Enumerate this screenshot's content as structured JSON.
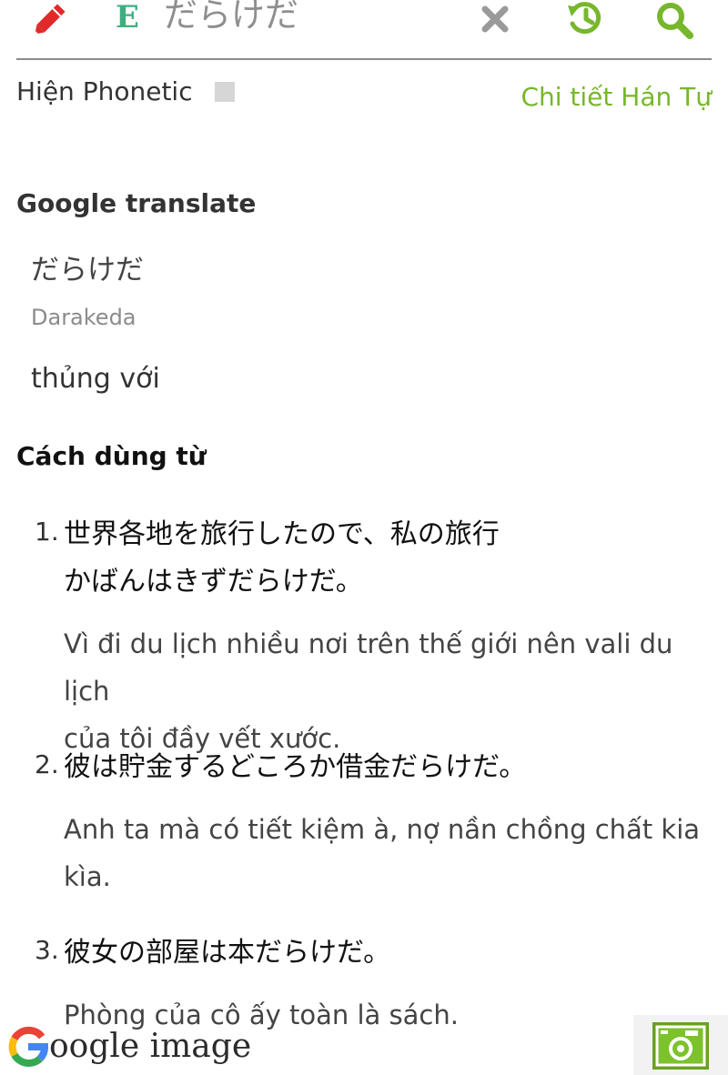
{
  "search": {
    "lang_badge": "E",
    "query": "だらけだ"
  },
  "phonetic": {
    "label": "Hiện Phonetic",
    "kanji_detail_link": "Chi tiết Hán Tự"
  },
  "google_translate": {
    "heading": "Google translate",
    "word": "だらけだ",
    "romaji": "Darakeda",
    "meaning": "thủng với"
  },
  "usage": {
    "heading": "Cách dùng từ",
    "examples": [
      {
        "number": "1.",
        "jp_line1": "世界各地を旅行したので、私の旅行",
        "jp_line2": "かばんはきずだらけだ。",
        "vi_line1": "Vì đi du lịch nhiều nơi trên thế giới nên vali du lịch",
        "vi_line2": "của tôi đầy vết xước."
      },
      {
        "number": "2.",
        "jp_line1": "彼は貯金するどころか借金だらけだ。",
        "vi_line1": "Anh ta mà có tiết kiệm à, nợ nần chồng chất kia",
        "vi_line2": "kìa."
      },
      {
        "number": "3.",
        "jp_line1": "彼女の部屋は本だらけだ。",
        "vi_line1": "Phòng của cô ấy toàn là sách."
      }
    ]
  },
  "footer": {
    "google_image_label": "oogle image",
    "google_image_logo_letter": "G"
  },
  "colors": {
    "accent_green": "#77b72c",
    "badge_green": "#3fae7f",
    "pencil_red": "#e02a2a",
    "clear_gray": "#9a9a9a"
  },
  "icons": {
    "edit": "pencil-icon",
    "clear": "close-icon",
    "history": "history-icon",
    "search": "search-icon",
    "camera": "camera-icon",
    "google": "google-g-icon"
  }
}
